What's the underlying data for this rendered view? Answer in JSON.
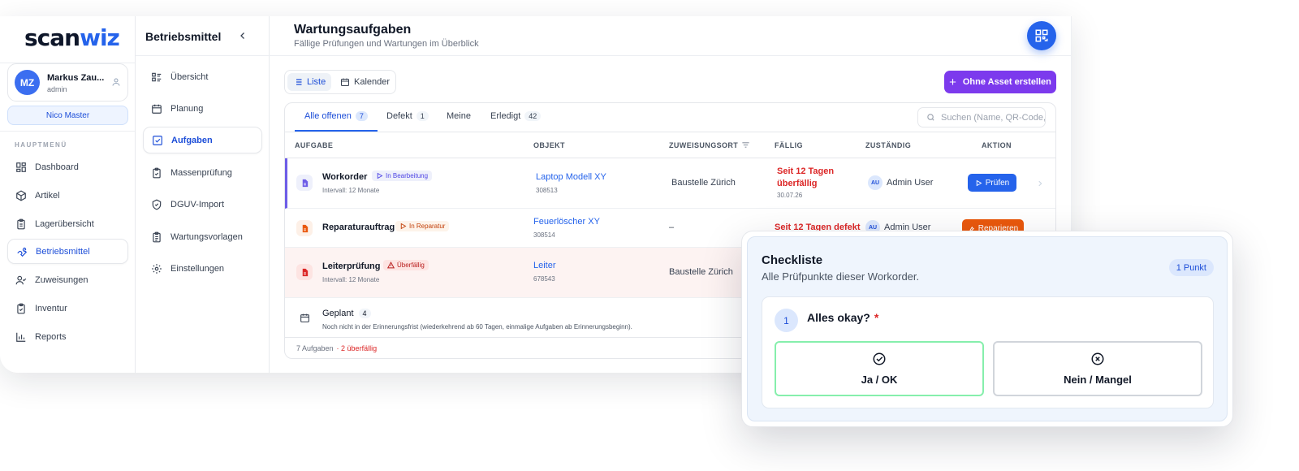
{
  "brand": {
    "part1": "scan",
    "part2": "wiz"
  },
  "user": {
    "initials": "MZ",
    "name": "Markus Zau...",
    "role": "admin",
    "tenant": "Nico Master"
  },
  "sidebar": {
    "section_label": "HAUPTMENÜ",
    "items": [
      {
        "label": "Dashboard",
        "icon": "dashboard-icon"
      },
      {
        "label": "Artikel",
        "icon": "box-icon"
      },
      {
        "label": "Lagerübersicht",
        "icon": "clipboard-icon"
      },
      {
        "label": "Betriebsmittel",
        "icon": "wrench-icon",
        "active": true
      },
      {
        "label": "Zuweisungen",
        "icon": "user-check-icon"
      },
      {
        "label": "Inventur",
        "icon": "clipboard-check-icon"
      },
      {
        "label": "Reports",
        "icon": "bar-chart-icon"
      }
    ]
  },
  "subnav": {
    "title": "Betriebsmittel",
    "items": [
      {
        "label": "Übersicht",
        "icon": "list-icon"
      },
      {
        "label": "Planung",
        "icon": "calendar-icon"
      },
      {
        "label": "Aufgaben",
        "icon": "checkbox-icon",
        "active": true
      },
      {
        "label": "Massenprüfung",
        "icon": "clipboard-check-icon"
      },
      {
        "label": "DGUV-Import",
        "icon": "shield-check-icon"
      },
      {
        "label": "Wartungsvorlagen",
        "icon": "clipboard-list-icon"
      },
      {
        "label": "Einstellungen",
        "icon": "gear-icon"
      }
    ]
  },
  "header": {
    "title": "Wartungsaufgaben",
    "subtitle": "Fällige Prüfungen und Wartungen im Überblick"
  },
  "toolbar": {
    "view_list": "Liste",
    "view_calendar": "Kalender",
    "create_label": "Ohne Asset erstellen"
  },
  "tabs": [
    {
      "label": "Alle offenen",
      "count": "7",
      "active": true
    },
    {
      "label": "Defekt",
      "count": "1"
    },
    {
      "label": "Meine",
      "count": ""
    },
    {
      "label": "Erledigt",
      "count": "42"
    }
  ],
  "search": {
    "placeholder": "Suchen (Name, QR-Code, ..."
  },
  "table": {
    "columns": [
      "AUFGABE",
      "OBJEKT",
      "ZUWEISUNGSORT",
      "FÄLLIG",
      "ZUSTÄNDIG",
      "AKTION"
    ],
    "rows": [
      {
        "task": "Workorder",
        "status": "In Bearbeitung",
        "interval": "Intervall: 12 Monate",
        "object": "Laptop Modell XY",
        "object_id": "308513",
        "location": "Baustelle Zürich",
        "due_line1": "Seit 12 Tagen",
        "due_line2": "überfällig",
        "due_date": "30.07.26",
        "assignee_initials": "AU",
        "assignee": "Admin User",
        "action": "Prüfen"
      },
      {
        "task": "Reparaturauftrag",
        "status": "In Reparatur",
        "object": "Feuerlöscher XY",
        "object_id": "308514",
        "location": "–",
        "due_line1": "Seit 12 Tagen defekt",
        "assignee_initials": "AU",
        "assignee": "Admin User",
        "action": "Reparieren"
      },
      {
        "task": "Leiterprüfung",
        "status": "Überfällig",
        "interval": "Intervall: 12 Monate",
        "object": "Leiter",
        "object_id": "678543",
        "location": "Baustelle Zürich"
      }
    ],
    "planned": {
      "label": "Geplant",
      "count": "4",
      "note": "Noch nicht in der Erinnerungsfrist (wiederkehrend ab 60 Tagen, einmalige Aufgaben ab Erinnerungsbeginn)."
    },
    "footer_count": "7 Aufgaben",
    "footer_overdue": "· 2 überfällig"
  },
  "checklist": {
    "title": "Checkliste",
    "subtitle": "Alle Prüfpunkte dieser Workorder.",
    "badge": "1 Punkt",
    "question_number": "1",
    "question": "Alles okay?",
    "required_mark": "*",
    "yes_label": "Ja / OK",
    "no_label": "Nein / Mangel"
  },
  "colors": {
    "primary": "#2563eb",
    "purple": "#7c3aed",
    "danger": "#dc2626",
    "orange": "#ea580c"
  }
}
